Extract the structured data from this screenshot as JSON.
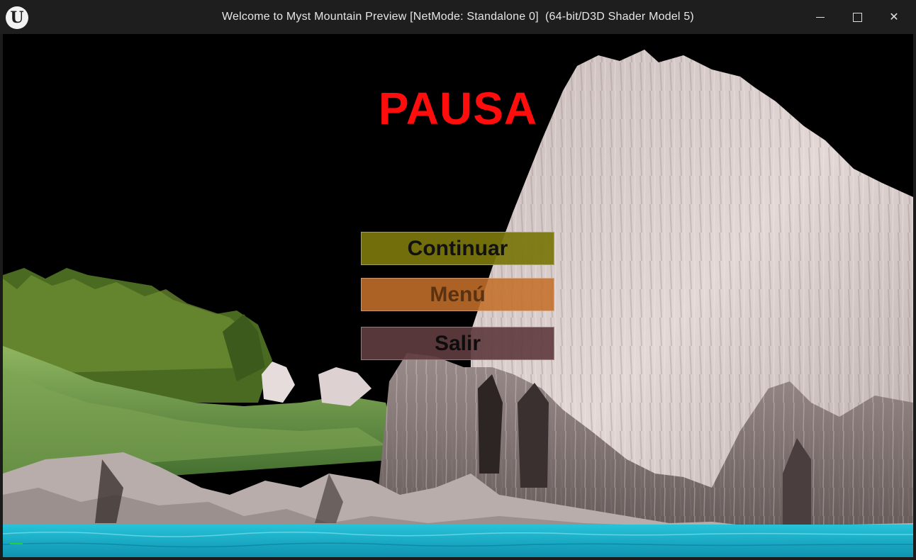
{
  "window": {
    "title": "Welcome to Myst Mountain Preview [NetMode: Standalone 0]  (64-bit/D3D Shader Model 5)",
    "logo_glyph": "U",
    "minimize_icon": "minimize-icon",
    "maximize_icon": "maximize-icon",
    "close_glyph": "✕"
  },
  "pause_menu": {
    "title": "PAUSA",
    "title_color": "#ff0d0d",
    "buttons": {
      "continue": "Continuar",
      "menu": "Menú",
      "exit": "Salir"
    }
  },
  "scene": {
    "sky_color": "#000000",
    "water_color": "#18b0c8",
    "mountain_color": "#d8cdcc",
    "foliage_color": "#5d8a3a"
  }
}
